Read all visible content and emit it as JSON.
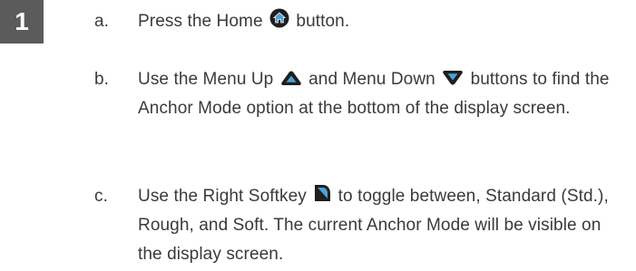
{
  "step": {
    "number": "1"
  },
  "instructions": [
    {
      "marker": "a.",
      "parts": [
        "Press the Home",
        "button."
      ]
    },
    {
      "marker": "b.",
      "parts": [
        "Use the Menu Up",
        "and Menu Down",
        "buttons to find the Anchor Mode option at the bottom of the display screen."
      ]
    },
    {
      "marker": "c.",
      "parts": [
        "Use the Right Softkey",
        "to toggle between, Standard (Std.), Rough, and Soft. The current Anchor Mode will be visible on the display screen."
      ]
    }
  ],
  "icons": {
    "home": "home-button-icon",
    "menu_up": "menu-up-button-icon",
    "menu_down": "menu-down-button-icon",
    "right_softkey": "right-softkey-icon"
  },
  "colors": {
    "badge_bg": "#5b5b5b",
    "badge_text": "#ffffff",
    "text": "#3a3a3a",
    "icon_dark": "#1f1f1f",
    "icon_accent": "#4aa3d8"
  }
}
